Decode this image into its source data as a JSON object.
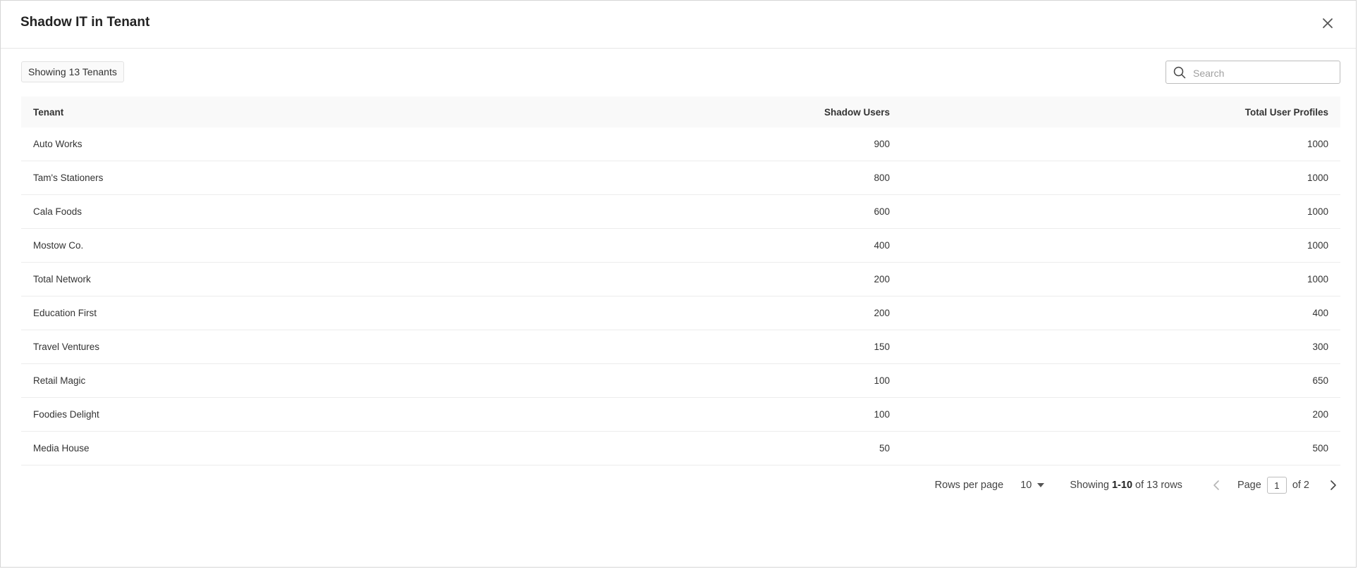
{
  "modal": {
    "title": "Shadow IT in Tenant"
  },
  "toolbar": {
    "count_label": "Showing 13 Tenants",
    "search_placeholder": "Search",
    "search_value": ""
  },
  "table": {
    "columns": [
      "Tenant",
      "Shadow Users",
      "Total User Profiles"
    ],
    "rows": [
      {
        "tenant": "Auto Works",
        "shadow": "900",
        "total": "1000"
      },
      {
        "tenant": "Tam's Stationers",
        "shadow": "800",
        "total": "1000"
      },
      {
        "tenant": "Cala Foods",
        "shadow": "600",
        "total": "1000"
      },
      {
        "tenant": "Mostow Co.",
        "shadow": "400",
        "total": "1000"
      },
      {
        "tenant": "Total Network",
        "shadow": "200",
        "total": "1000"
      },
      {
        "tenant": "Education First",
        "shadow": "200",
        "total": "400"
      },
      {
        "tenant": "Travel Ventures",
        "shadow": "150",
        "total": "300"
      },
      {
        "tenant": "Retail Magic",
        "shadow": "100",
        "total": "650"
      },
      {
        "tenant": "Foodies Delight",
        "shadow": "100",
        "total": "200"
      },
      {
        "tenant": "Media House",
        "shadow": "50",
        "total": "500"
      }
    ]
  },
  "pagination": {
    "rows_per_page_label": "Rows per page",
    "rows_per_page_value": "10",
    "showing_prefix": "Showing ",
    "showing_range": "1-10",
    "showing_suffix": " of 13 rows",
    "page_label": "Page",
    "current_page": "1",
    "of_pages": "of 2"
  },
  "icons": {
    "close": "close-icon",
    "search": "search-icon",
    "caret": "caret-down-icon",
    "prev": "chevron-left-icon",
    "next": "chevron-right-icon"
  }
}
